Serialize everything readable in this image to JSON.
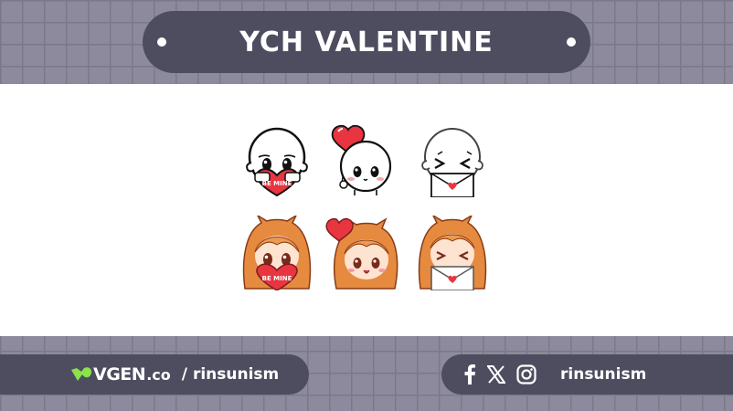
{
  "header": {
    "title": "YCH VALENTINE"
  },
  "emotes": {
    "top_row": [
      "base-heart-be-mine",
      "base-heart-balloon",
      "base-love-letter"
    ],
    "bottom_row": [
      "girl-heart-be-mine",
      "girl-heart-balloon",
      "girl-love-letter"
    ],
    "heart_text": "BE MINE"
  },
  "footer_left": {
    "site_brand": "VGEN",
    "site_tld": ".co",
    "separator": "/",
    "handle": "rinsunism"
  },
  "footer_right": {
    "icons": [
      "facebook-icon",
      "x-icon",
      "instagram-icon"
    ],
    "handle": "rinsunism"
  },
  "colors": {
    "background": "#8c8a9c",
    "pill": "#4e4d60",
    "accent_green": "#8be24a",
    "heart_red": "#e8353f"
  }
}
